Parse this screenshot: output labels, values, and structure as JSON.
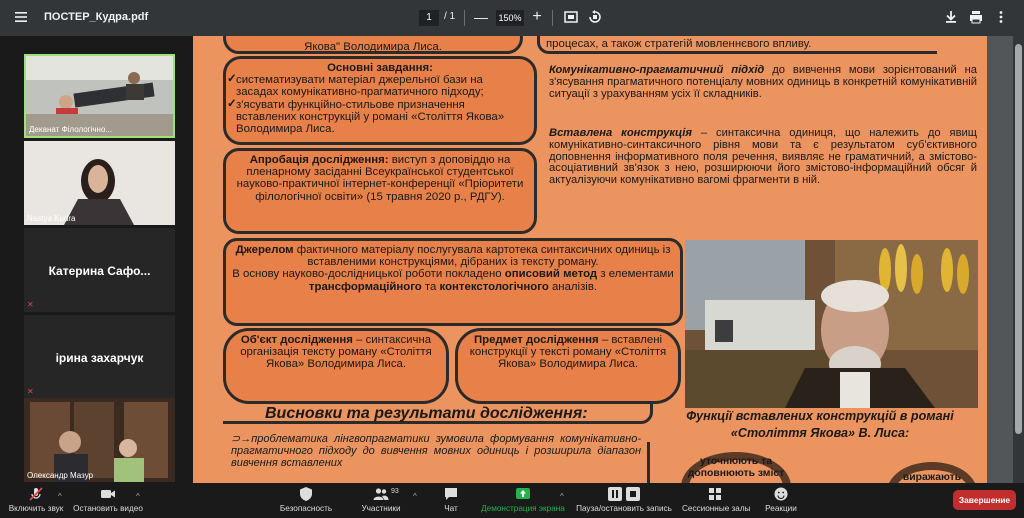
{
  "pdf": {
    "title": "ПОСТЕР_Кудра.pdf",
    "page_current": "1",
    "page_total": "/  1",
    "zoom": "150%",
    "minus": "—",
    "plus": "+"
  },
  "poster": {
    "top_left_fragment": "Якова\" Володимира Лиса.",
    "tasks_title": "Основні завдання:",
    "task_1": "систематизувати матеріал джерельної бази на засадах комунікативно-прагматичного підходу;",
    "task_2": "з'ясувати функційно-стильове призначення вставлених конструкцій у романі «Століття Якова» Володимира Лиса.",
    "approbation_label": "Апробація дослідження:",
    "approbation_text": " виступ з доповіддю на пленарному засіданні Всеукраїнської студентської науково-практичної інтернет-конференції «Пріоритети філологічної освіти» (15 травня 2020 р., РДГУ).",
    "top_right_fragment": "процесах, а також стратегій мовленнєвого впливу.",
    "comm_label": "Комунікативно-прагматичний підхід",
    "comm_text": " до вивчення мови зорієнтований на з'ясування прагматичного потенціалу мовних одиниць в конкретній комунікативній ситуації з урахуванням усіх її складників.",
    "insert_label": "Вставлена конструкція",
    "insert_text": " – синтаксична одиниця, що належить до явищ комунікативно-синтаксичного рівня мови та є результатом суб'єктивного доповнення інформативного поля речення, виявляє не граматичний, а змістово-асоціативний зв'язок з нею, розширюючи його змістово-інформаційний обсяг й актуалізуючи комунікативно вагомі фрагменти в ній.",
    "source_bold": "Джерелом",
    "source_text_1": " фактичного матеріалу послугувала картотека синтаксичних одиниць із вставленими конструкціями, дібраних із тексту роману.",
    "source_text_2": "В основу науково-дослідницької роботи покладено ",
    "method_bold_1": "описовий метод",
    "method_text": " з елементами ",
    "method_bold_2": "трансформаційного",
    "method_and": " та ",
    "method_bold_3": "контекстологічного",
    "method_end": " аналізів.",
    "object_label": "Об'єкт дослідження",
    "object_text": " – синтаксична організація тексту роману «Століття Якова» Володимира Лиса.",
    "subject_label": "Предмет дослідження",
    "subject_text": " – вставлені конструкції у тексті роману «Століття Якова» Володимира Лиса.",
    "conclusions_title": "Висновки та результати дослідження:",
    "conclusion_1": "проблематика лінгвопрагматики зумовила формування комунікативно-прагматичного підходу до вивчення мовних одиниць і розширила діапазон вивчення вставлених",
    "functions_title_1": "Функції вставлених конструкцій в романі",
    "functions_title_2": "«Століття Якова» В. Лиса:",
    "function_1": "уточнюють та доповнюють зміст",
    "function_2": "виражають"
  },
  "participants": [
    {
      "name": "Деканат Філологічно...",
      "type": "video"
    },
    {
      "name": "Nastya Kudra",
      "type": "video"
    },
    {
      "name": "Катерина  Сафо...",
      "type": "name"
    },
    {
      "name": "ірина  захарчук",
      "type": "name"
    },
    {
      "name": "Олександр Мазур",
      "type": "video"
    }
  ],
  "toolbar": {
    "mute": "Включить звук",
    "video": "Остановить видео",
    "security": "Безопасность",
    "participants": "Участники",
    "participants_count": "93",
    "chat": "Чат",
    "share": "Демонстрация экрана",
    "record": "Пауза/остановить запись",
    "rooms": "Сессионные залы",
    "reactions": "Реакции",
    "end": "Завершение"
  },
  "colors": {
    "poster_bg": "#eb9460",
    "box_bg": "#e8804a",
    "share_green": "#24b24c",
    "end_red": "#c22d2d"
  }
}
